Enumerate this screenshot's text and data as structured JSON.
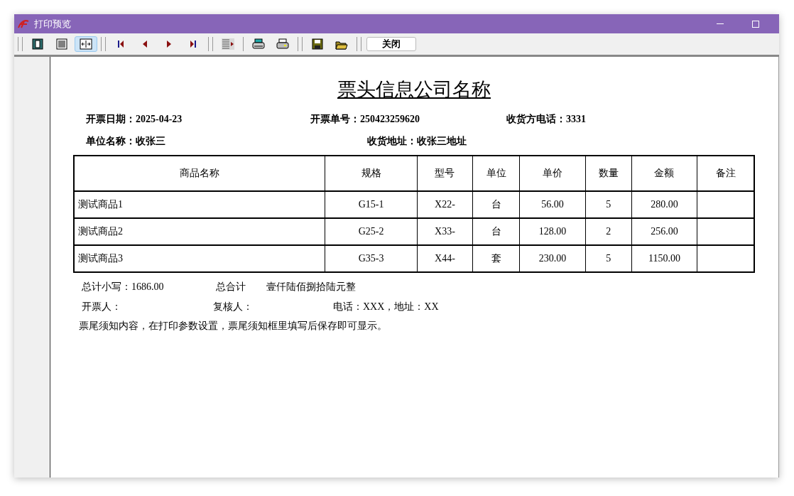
{
  "window": {
    "title": "打印预览"
  },
  "toolbar": [
    {
      "kind": "icon",
      "selected": false
    },
    {
      "kind": "icon",
      "selected": false
    },
    {
      "kind": "icon",
      "selected": true
    },
    {
      "kind": "grip"
    },
    {
      "kind": "icon",
      "selected": false
    },
    {
      "kind": "icon",
      "selected": false
    },
    {
      "kind": "icon",
      "selected": false
    },
    {
      "kind": "icon",
      "selected": false
    },
    {
      "kind": "grip"
    },
    {
      "kind": "icon",
      "selected": false
    },
    {
      "kind": "sep"
    },
    {
      "kind": "icon",
      "selected": false
    },
    {
      "kind": "icon",
      "selected": false
    },
    {
      "kind": "grip"
    },
    {
      "kind": "icon",
      "selected": false
    },
    {
      "kind": "icon",
      "selected": false
    },
    {
      "kind": "grip"
    },
    {
      "kind": "text",
      "label": "关闭"
    }
  ],
  "report": {
    "title": "票头信息公司名称",
    "header_rows": [
      [
        "开票日期：2025-04-23",
        "开票单号：250423259620",
        "收货方电话：3331"
      ],
      [
        "单位名称：收张三",
        "收货地址：收张三地址"
      ]
    ],
    "table": {
      "columns": [
        "商品名称",
        "规格",
        "型号",
        "单位",
        "单价",
        "数量",
        "金额",
        "备注"
      ],
      "rows": [
        [
          "测试商品1",
          "G15-1",
          "X22-",
          "台",
          "56.00",
          "5",
          "280.00",
          ""
        ],
        [
          "测试商品2",
          "G25-2",
          "X33-",
          "台",
          "128.00",
          "2",
          "256.00",
          ""
        ],
        [
          "测试商品3",
          "G35-3",
          "X44-",
          "套",
          "230.00",
          "5",
          "1150.00",
          ""
        ]
      ]
    },
    "footer_rows": [
      [
        "总计小写：1686.00",
        "总合计",
        "壹仟陆佰捌拾陆元整"
      ],
      [
        "开票人：",
        "复核人：",
        "电话：XXX，地址：XX"
      ]
    ],
    "note": "票尾须知内容，在打印参数设置，票尾须知框里填写后保存即可显示。"
  }
}
